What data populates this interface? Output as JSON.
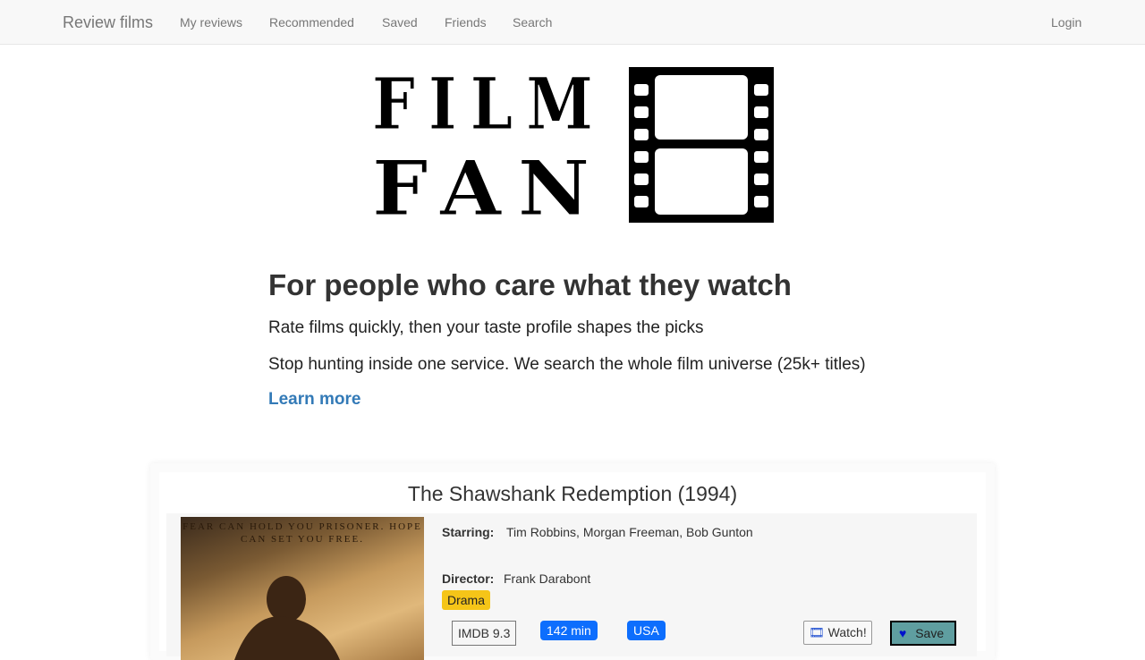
{
  "nav": {
    "brand": "Review films",
    "links": [
      "My reviews",
      "Recommended",
      "Saved",
      "Friends",
      "Search"
    ],
    "login": "Login"
  },
  "logo": {
    "line1": "FILM",
    "line2": "FAN",
    "icon": "film-strip-icon"
  },
  "hero": {
    "title": "For people who care what they watch",
    "line1": "Rate films quickly, then your taste profile shapes the picks",
    "line2": "Stop hunting inside one service. We search the whole film universe (25k+ titles)",
    "learn_more": "Learn more"
  },
  "film": {
    "title": "The Shawshank Redemption (1994)",
    "poster_text": "FEAR CAN HOLD YOU PRISONER. HOPE CAN SET YOU FREE.",
    "starring_label": "Starring:",
    "starring": "Tim Robbins, Morgan Freeman, Bob Gunton",
    "director_label": "Director:",
    "director": "Frank Darabont",
    "genre": "Drama",
    "imdb": "IMDB 9.3",
    "runtime": "142 min",
    "country": "USA",
    "watch_label": "Watch!",
    "save_label": "Save"
  },
  "colors": {
    "link": "#337ab7",
    "genre_badge": "#f5c518",
    "pill": "#0d6efd",
    "save_button": "#5f9ea0"
  }
}
